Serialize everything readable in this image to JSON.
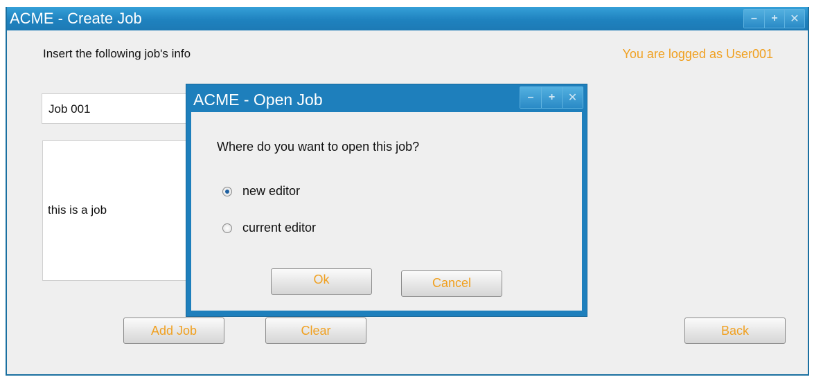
{
  "main_window": {
    "title": "ACME - Create Job",
    "controls": {
      "minimize": "–",
      "maximize": "+",
      "close": "✕"
    },
    "intro_text": "Insert the following job's info",
    "logged_text": "You are logged as User001",
    "job_name_value": "Job 001",
    "job_description_value": "this is a job",
    "buttons": {
      "add_job": "Add Job",
      "clear": "Clear",
      "back": "Back"
    }
  },
  "dialog": {
    "title": "ACME - Open Job",
    "controls": {
      "minimize": "–",
      "maximize": "+",
      "close": "✕"
    },
    "question": "Where do you want to open this job?",
    "options": [
      {
        "label": "new editor",
        "selected": true
      },
      {
        "label": "current editor",
        "selected": false
      }
    ],
    "buttons": {
      "ok": "Ok",
      "cancel": "Cancel"
    }
  },
  "colors": {
    "accent_text": "#f0a020",
    "titlebar_blue": "#1f82bf"
  }
}
